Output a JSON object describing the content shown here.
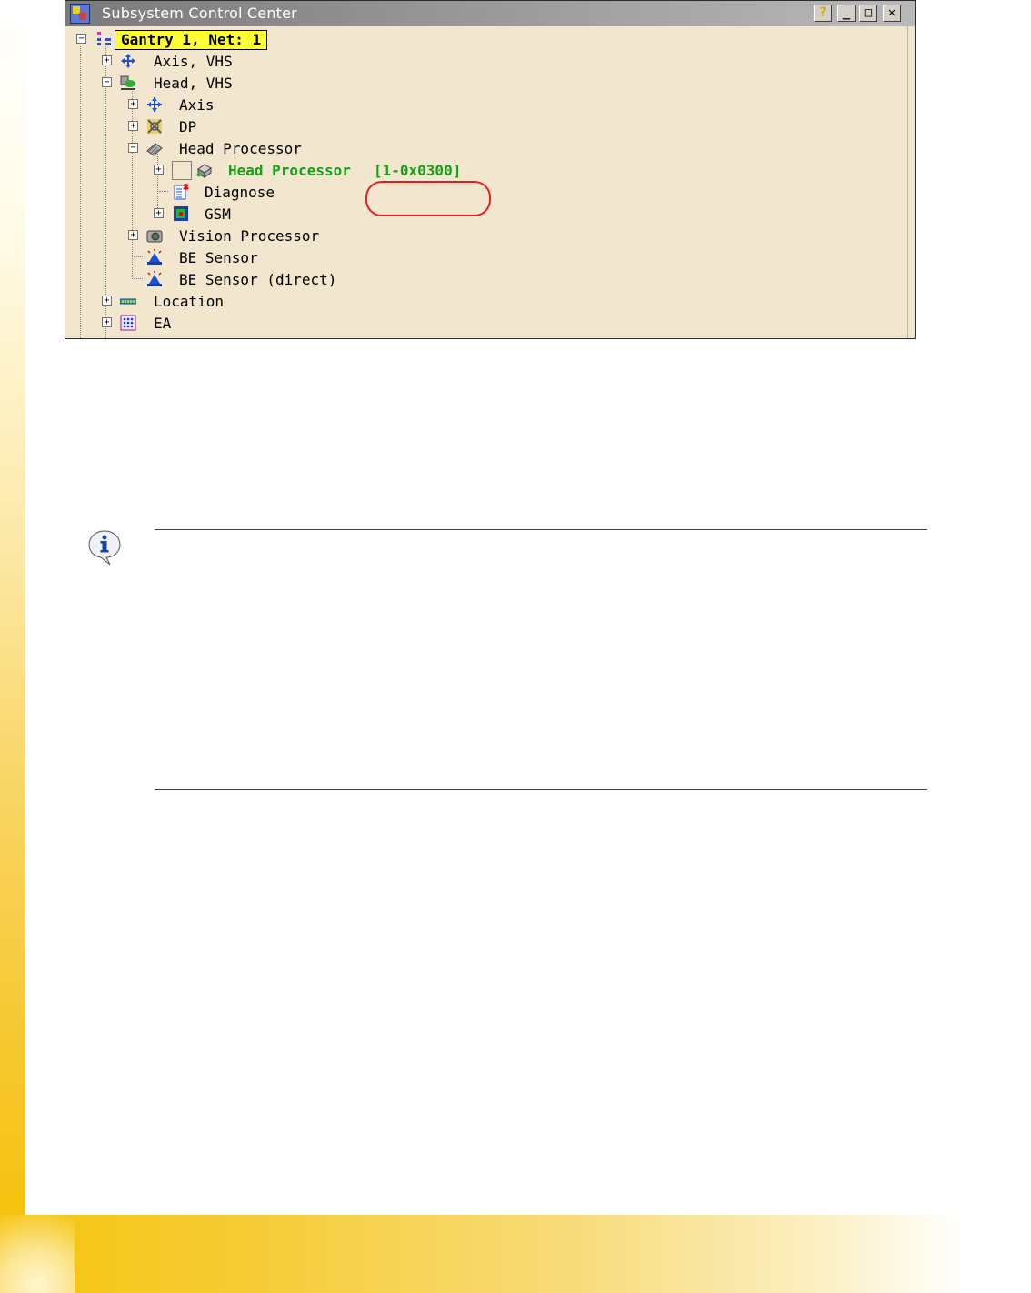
{
  "window": {
    "title": "Subsystem Control Center",
    "buttons": {
      "help": "?",
      "minimize": "_",
      "maximize": "□",
      "close": "✕"
    }
  },
  "tree": {
    "root": {
      "label": "Gantry 1, Net: 1",
      "expander": "−"
    },
    "items": [
      {
        "label": "Axis, VHS",
        "expander": "+",
        "icon": "move-axis-icon"
      },
      {
        "label": "Head, VHS",
        "expander": "−",
        "icon": "head-icon"
      },
      {
        "label": "Axis",
        "expander": "+",
        "icon": "axis-icon"
      },
      {
        "label": "DP",
        "expander": "+",
        "icon": "dp-icon"
      },
      {
        "label": "Head Processor",
        "expander": "−",
        "icon": "processor-chip-icon"
      },
      {
        "label": "Head Processor",
        "address": "[1-0x0300]",
        "expander": "+",
        "icon": "device-icon",
        "highlighted": true
      },
      {
        "label": "Diagnose",
        "icon": "diagnose-icon"
      },
      {
        "label": "GSM",
        "expander": "+",
        "icon": "gsm-icon"
      },
      {
        "label": "Vision Processor",
        "expander": "+",
        "icon": "camera-icon"
      },
      {
        "label": "BE Sensor",
        "icon": "sensor-icon"
      },
      {
        "label": "BE Sensor (direct)",
        "icon": "sensor-icon"
      },
      {
        "label": "Location",
        "expander": "+",
        "icon": "location-icon"
      },
      {
        "label": "EA",
        "expander": "+",
        "icon": "ea-grid-icon"
      }
    ]
  },
  "note": {
    "icon": "info-icon"
  },
  "colors": {
    "window_background": "#f3e6cf",
    "root_highlight": "#ffff33",
    "active_node_text": "#16a016",
    "callout_ring": "#e02020",
    "page_accent": "#f5c20f"
  }
}
